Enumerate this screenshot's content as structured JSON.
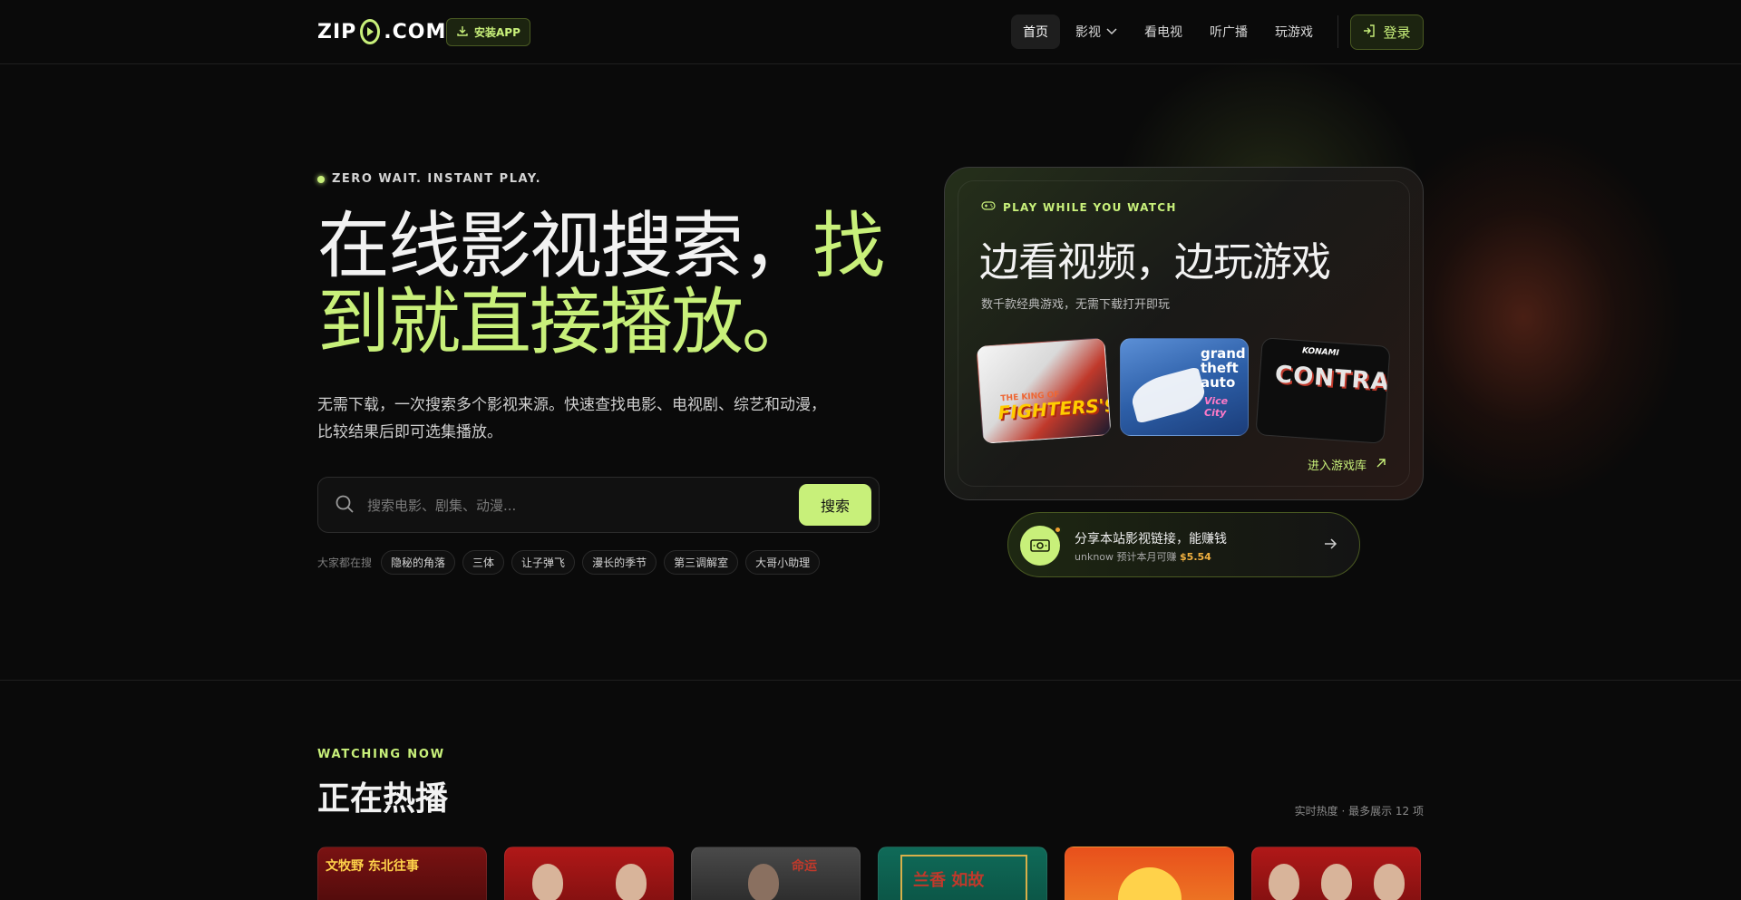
{
  "nav": {
    "logo_left": "ZIP",
    "logo_right": ".COM",
    "install_label": "安装APP",
    "menu": [
      {
        "label": "首页",
        "active": true
      },
      {
        "label": "影视",
        "has_dropdown": true
      },
      {
        "label": "看电视"
      },
      {
        "label": "听广播"
      },
      {
        "label": "玩游戏"
      }
    ],
    "login_label": "登录"
  },
  "hero": {
    "eyebrow": "ZERO WAIT. INSTANT PLAY.",
    "title_plain": "在线影视搜索，",
    "title_highlight_1": "找",
    "title_highlight_2": "到就直接播放。",
    "desc_line1": "无需下载，一次搜索多个影视来源。快速查找电影、电视剧、综艺和动漫，",
    "desc_line2": "比较结果后即可选集播放。",
    "search_placeholder": "搜索电影、剧集、动漫...",
    "search_button": "搜索",
    "hot_label": "大家都在搜",
    "hot_terms": [
      "隐秘的角落",
      "三体",
      "让子弹飞",
      "漫长的季节",
      "第三调解室",
      "大哥小助理"
    ]
  },
  "game_card": {
    "eyebrow": "PLAY WHILE YOU WATCH",
    "title": "边看视频，边玩游戏",
    "subtitle": "数千款经典游戏，无需下载打开即玩",
    "games": [
      {
        "name": "THE KING OF FIGHTERS '97",
        "cover_text": "FIGHTERS'97",
        "cover_sub": "THE KING OF"
      },
      {
        "name": "Grand Theft Auto Vice City",
        "cover_text": "grand theft auto",
        "cover_sub": "Vice City"
      },
      {
        "name": "Contra",
        "cover_text": "CONTRA",
        "cover_sub": "KONAMI"
      }
    ],
    "link_label": "进入游戏库"
  },
  "share": {
    "title": "分享本站影视链接，能赚钱",
    "meta_prefix": "unknow 预计本月可赚",
    "amount": "$5.54"
  },
  "watching": {
    "eyebrow": "WATCHING NOW",
    "title": "正在热播",
    "note": "实时热度 · 最多展示 12 项",
    "posters": [
      {
        "caption": "文牧野 东北往事"
      },
      {
        "caption": ""
      },
      {
        "caption": "命运"
      },
      {
        "caption": "兰香 如故"
      },
      {
        "caption": ""
      },
      {
        "caption": ""
      }
    ]
  },
  "colors": {
    "accent": "#c8f07a",
    "background": "#0a0a0a",
    "amount": "#f0b040"
  }
}
